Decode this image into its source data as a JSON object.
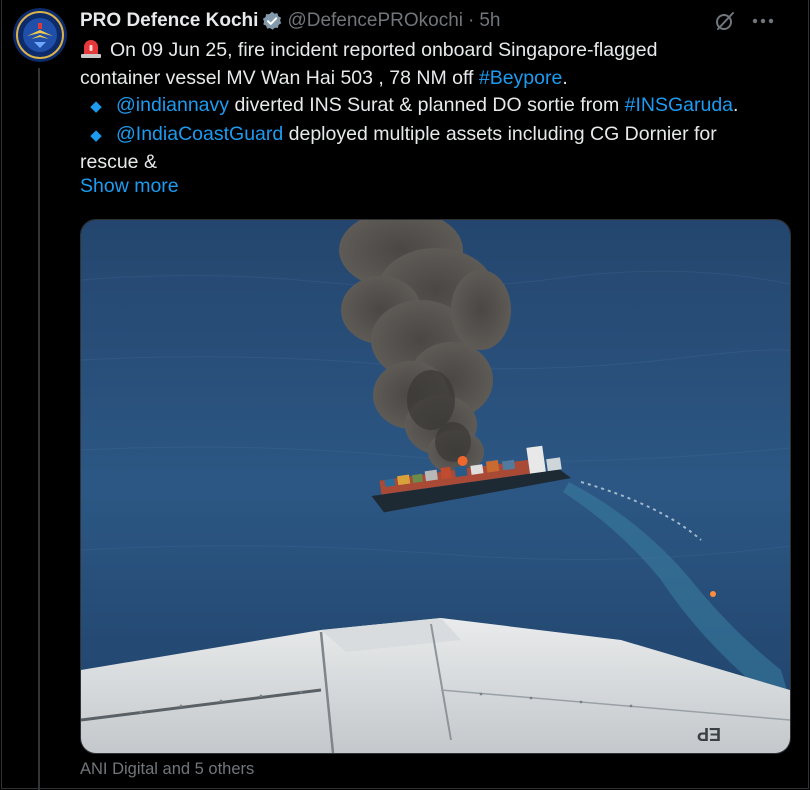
{
  "tweet": {
    "display_name": "PRO Defence Kochi",
    "handle": "@DefencePROkochi",
    "separator": "·",
    "time": "5h",
    "lines": [
      {
        "pre_icon": "siren-emoji",
        "text": "On 09 Jun 25, fire incident reported onboard Singapore-flagged"
      },
      {
        "text_before": "container vessel MV Wan Hai 503 , 78 NM off ",
        "hashtag": "#Beypore",
        "text_after": "."
      },
      {
        "bullet": "◆",
        "mention": "@indiannavy",
        "text_mid": " diverted INS Surat & planned DO sortie from ",
        "hashtag": "#INSGaruda",
        "text_after": "."
      },
      {
        "bullet": "◆",
        "mention": "@IndiaCoastGuard",
        "text_after": " deployed multiple assets including CG Dornier for"
      },
      {
        "text": "rescue &"
      }
    ],
    "show_more": "Show more",
    "media_alt": "aerial photo of burning container ship at sea seen from aircraft wing",
    "tagged": "ANI Digital and 5 others"
  },
  "icons": {
    "verified": "verified-badge-icon",
    "grok": "grok-icon",
    "more": "more-icon",
    "siren": "siren-icon",
    "bullet": "blue-diamond-icon"
  },
  "colors": {
    "background": "#000000",
    "text": "#e7e9ea",
    "muted": "#71767b",
    "link": "#1d9bf0",
    "border": "#2f3336"
  }
}
